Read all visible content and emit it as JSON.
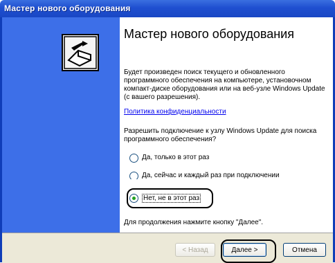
{
  "window": {
    "title": "Мастер нового оборудования"
  },
  "banner": {
    "icon": "hardware-wizard-icon"
  },
  "content": {
    "heading": "Мастер нового оборудования",
    "intro": "Будет произведен поиск текущего и обновленного программного обеспечения на компьютере, установочном компакт-диске оборудования или на веб-узле Windows Update (с вашего разрешения).",
    "privacy_link": "Политика конфиденциальности",
    "question": "Разрешить подключение к узлу Windows Update для поиска программного обеспечения?",
    "options": [
      {
        "label": "Да, только в этот раз",
        "selected": false
      },
      {
        "label": "Да, сейчас и каждый раз при подключении устройства",
        "selected": false
      },
      {
        "label": "Нет, не в этот раз",
        "selected": true
      }
    ],
    "continue_hint": "Для продолжения нажмите кнопку \"Далее\"."
  },
  "buttons": {
    "back": "< Назад",
    "next": "Далее >",
    "cancel": "Отмена"
  }
}
